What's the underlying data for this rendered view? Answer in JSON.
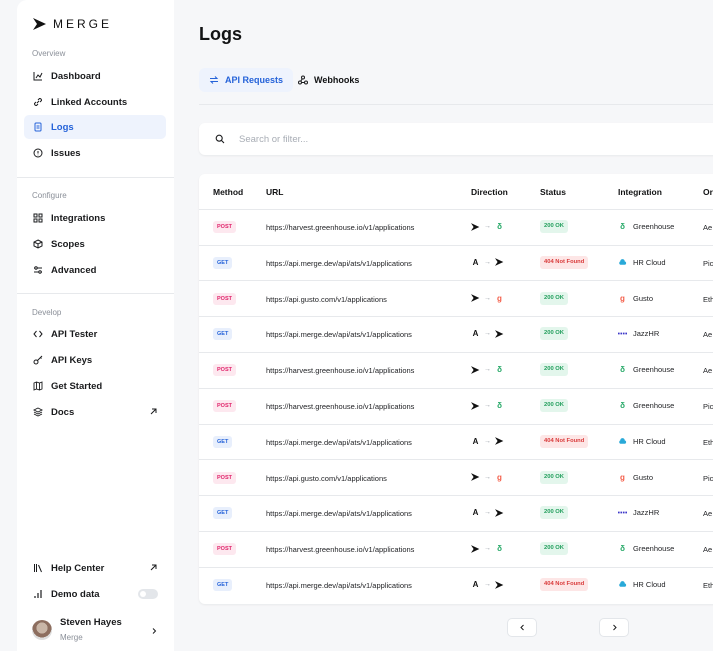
{
  "app": {
    "brand": "MERGE"
  },
  "sidebar": {
    "sections": {
      "overview": "Overview",
      "configure": "Configure",
      "develop": "Develop"
    },
    "items": [
      {
        "label": "Dashboard",
        "icon": "chart-icon"
      },
      {
        "label": "Linked Accounts",
        "icon": "link-icon"
      },
      {
        "label": "Logs",
        "icon": "logs-icon",
        "active": true
      },
      {
        "label": "Issues",
        "icon": "alert-icon"
      },
      {
        "label": "Integrations",
        "icon": "grid-icon"
      },
      {
        "label": "Scopes",
        "icon": "cube-icon"
      },
      {
        "label": "Advanced",
        "icon": "sliders-icon"
      },
      {
        "label": "API Tester",
        "icon": "code-icon"
      },
      {
        "label": "API Keys",
        "icon": "key-icon"
      },
      {
        "label": "Get Started",
        "icon": "map-icon"
      },
      {
        "label": "Docs",
        "icon": "stack-icon"
      }
    ],
    "bottom": {
      "help_center": "Help Center",
      "demo_data": "Demo data",
      "demo_data_enabled": false
    },
    "user": {
      "name": "Steven Hayes",
      "org": "Merge"
    }
  },
  "main": {
    "title": "Logs",
    "tabs": [
      {
        "label": "API Requests",
        "active": true
      },
      {
        "label": "Webhooks",
        "active": false
      }
    ],
    "search": {
      "placeholder": "Search or filter...",
      "value": ""
    },
    "table": {
      "headers": [
        "Method",
        "URL",
        "Direction",
        "Status",
        "Integration",
        "Or"
      ],
      "rows": [
        {
          "method": "POST",
          "url": "https://harvest.greenhouse.io/v1/applications",
          "dir_from": "merge",
          "dir_to": "greenhouse",
          "status": "200 OK",
          "integration": "Greenhouse",
          "org": "Ae"
        },
        {
          "method": "GET",
          "url": "https://api.merge.dev/api/ats/v1/applications",
          "dir_from": "A",
          "dir_to": "merge",
          "status": "404 Not Found",
          "integration": "HR Cloud",
          "org": "Pic"
        },
        {
          "method": "POST",
          "url": "https://api.gusto.com/v1/applications",
          "dir_from": "merge",
          "dir_to": "gusto",
          "status": "200 OK",
          "integration": "Gusto",
          "org": "Eth"
        },
        {
          "method": "GET",
          "url": "https://api.merge.dev/api/ats/v1/applications",
          "dir_from": "A",
          "dir_to": "merge",
          "status": "200 OK",
          "integration": "JazzHR",
          "org": "Ae"
        },
        {
          "method": "POST",
          "url": "https://harvest.greenhouse.io/v1/applications",
          "dir_from": "merge",
          "dir_to": "greenhouse",
          "status": "200 OK",
          "integration": "Greenhouse",
          "org": "Ae"
        },
        {
          "method": "POST",
          "url": "https://harvest.greenhouse.io/v1/applications",
          "dir_from": "merge",
          "dir_to": "greenhouse",
          "status": "200 OK",
          "integration": "Greenhouse",
          "org": "Pic"
        },
        {
          "method": "GET",
          "url": "https://api.merge.dev/api/ats/v1/applications",
          "dir_from": "A",
          "dir_to": "merge",
          "status": "404 Not Found",
          "integration": "HR Cloud",
          "org": "Eth"
        },
        {
          "method": "POST",
          "url": "https://api.gusto.com/v1/applications",
          "dir_from": "merge",
          "dir_to": "gusto",
          "status": "200 OK",
          "integration": "Gusto",
          "org": "Pic"
        },
        {
          "method": "GET",
          "url": "https://api.merge.dev/api/ats/v1/applications",
          "dir_from": "A",
          "dir_to": "merge",
          "status": "200 OK",
          "integration": "JazzHR",
          "org": "Ae"
        },
        {
          "method": "POST",
          "url": "https://harvest.greenhouse.io/v1/applications",
          "dir_from": "merge",
          "dir_to": "greenhouse",
          "status": "200 OK",
          "integration": "Greenhouse",
          "org": "Ae"
        },
        {
          "method": "GET",
          "url": "https://api.merge.dev/api/ats/v1/applications",
          "dir_from": "A",
          "dir_to": "merge",
          "status": "404 Not Found",
          "integration": "HR Cloud",
          "org": "Eth"
        }
      ]
    }
  },
  "colors": {
    "accent": "#2563d9",
    "post_bg": "#fde8ef",
    "post_fg": "#e0246b",
    "get_bg": "#e8effc",
    "get_fg": "#2563d9",
    "ok_bg": "#e3f6ec",
    "ok_fg": "#1f9d5a",
    "nf_bg": "#fde6e6",
    "nf_fg": "#d93a3a",
    "greenhouse": "#24a866",
    "gusto": "#f45d48",
    "hrcloud": "#29a9d8",
    "jazzhr": "#3b36c9"
  }
}
